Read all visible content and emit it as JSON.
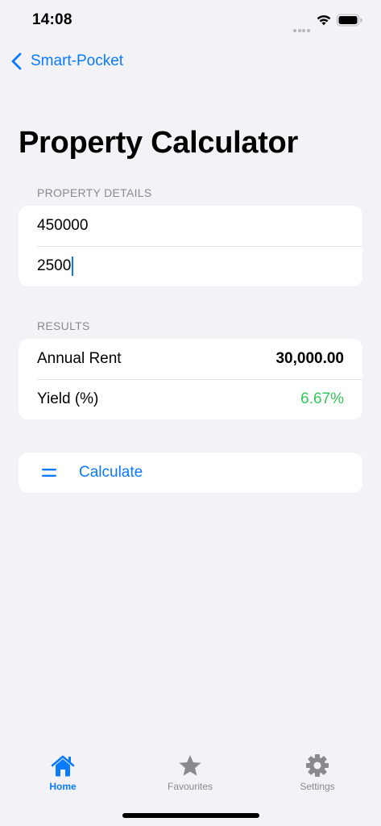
{
  "status_bar": {
    "time": "14:08"
  },
  "nav": {
    "back_label": "Smart-Pocket"
  },
  "page": {
    "title": "Property Calculator"
  },
  "property_details": {
    "header": "PROPERTY DETAILS",
    "price_value": "450000",
    "rent_value": "2500"
  },
  "results": {
    "header": "RESULTS",
    "rows": [
      {
        "label": "Annual Rent",
        "value": "30,000.00"
      },
      {
        "label": "Yield (%)",
        "value": "6.67%"
      }
    ]
  },
  "actions": {
    "calculate_label": "Calculate"
  },
  "tab_bar": {
    "tabs": [
      {
        "label": "Home",
        "icon": "house-icon",
        "active": true
      },
      {
        "label": "Favourites",
        "icon": "star-icon",
        "active": false
      },
      {
        "label": "Settings",
        "icon": "gear-icon",
        "active": false
      }
    ]
  },
  "colors": {
    "accent": "#0a7aff",
    "positive": "#34c759",
    "background": "#f2f2f7",
    "secondary_text": "#8a8a8e"
  }
}
